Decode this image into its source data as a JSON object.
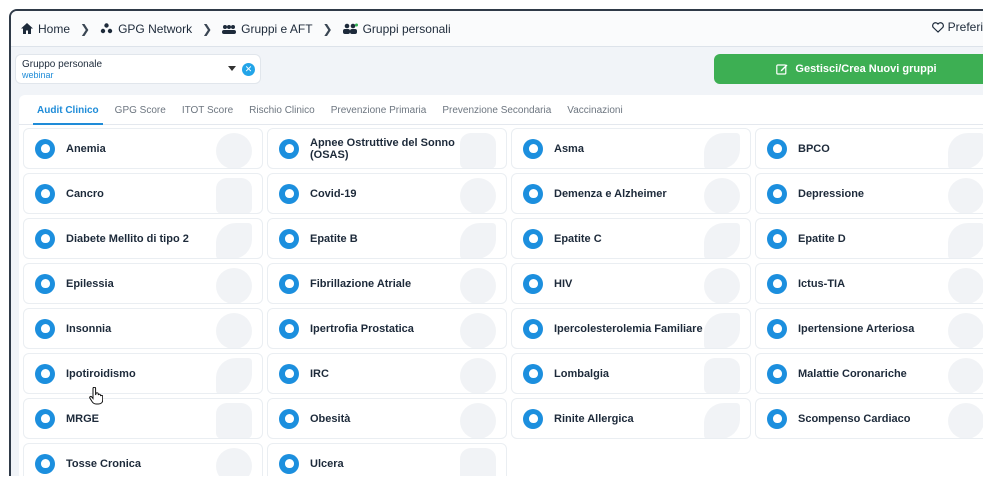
{
  "breadcrumb": {
    "home": "Home",
    "network": "GPG Network",
    "groups": "Gruppi e AFT",
    "personal": "Gruppi personali"
  },
  "favorites": "Preferiti",
  "group_select": {
    "label": "Gruppo personale",
    "value": "webinar"
  },
  "manage_button": "Gestisci/Crea Nuovi gruppi",
  "tabs": [
    {
      "label": "Audit Clinico",
      "active": true
    },
    {
      "label": "GPG Score",
      "active": false
    },
    {
      "label": "ITOT Score",
      "active": false
    },
    {
      "label": "Rischio Clinico",
      "active": false
    },
    {
      "label": "Prevenzione Primaria",
      "active": false
    },
    {
      "label": "Prevenzione Secondaria",
      "active": false
    },
    {
      "label": "Vaccinazioni",
      "active": false
    }
  ],
  "conditions": [
    {
      "label": "Anemia",
      "icon": "heart-icon"
    },
    {
      "label": "Apnee Ostruttive del Sonno (OSAS)",
      "icon": "sleep-icon"
    },
    {
      "label": "Asma",
      "icon": "lungs-icon"
    },
    {
      "label": "BPCO",
      "icon": "lungs-icon"
    },
    {
      "label": "Cancro",
      "icon": "microscope-icon"
    },
    {
      "label": "Covid-19",
      "icon": "virus-icon"
    },
    {
      "label": "Demenza e Alzheimer",
      "icon": "brain-icon"
    },
    {
      "label": "Depressione",
      "icon": "brain-icon"
    },
    {
      "label": "Diabete Mellito di tipo 2",
      "icon": "drop-icon"
    },
    {
      "label": "Epatite B",
      "icon": "liver-icon"
    },
    {
      "label": "Epatite C",
      "icon": "liver-icon"
    },
    {
      "label": "Epatite D",
      "icon": "liver-icon"
    },
    {
      "label": "Epilessia",
      "icon": "brain-icon"
    },
    {
      "label": "Fibrillazione Atriale",
      "icon": "heart-icon"
    },
    {
      "label": "HIV",
      "icon": "virus-icon"
    },
    {
      "label": "Ictus-TIA",
      "icon": "brain-icon"
    },
    {
      "label": "Insonnia",
      "icon": "brain-icon"
    },
    {
      "label": "Ipertrofia Prostatica",
      "icon": "male-icon"
    },
    {
      "label": "Ipercolesterolemia Familiare",
      "icon": "drop-icon"
    },
    {
      "label": "Ipertensione Arteriosa",
      "icon": "heart-icon"
    },
    {
      "label": "Ipotiroidismo",
      "icon": "drop-icon"
    },
    {
      "label": "IRC",
      "icon": "kidney-icon"
    },
    {
      "label": "Lombalgia",
      "icon": "spine-icon"
    },
    {
      "label": "Malattie Coronariche",
      "icon": "heart-icon"
    },
    {
      "label": "MRGE",
      "icon": "stomach-icon"
    },
    {
      "label": "Obesità",
      "icon": "scale-icon"
    },
    {
      "label": "Rinite Allergica",
      "icon": "lungs-icon"
    },
    {
      "label": "Scompenso Cardiaco",
      "icon": "heart-icon"
    },
    {
      "label": "Tosse Cronica",
      "icon": "cough-icon"
    },
    {
      "label": "Ulcera",
      "icon": "stomach-icon"
    }
  ],
  "colors": {
    "accent_blue": "#1c8fde",
    "green_button": "#3daf53",
    "background": "#f1f4f8"
  }
}
